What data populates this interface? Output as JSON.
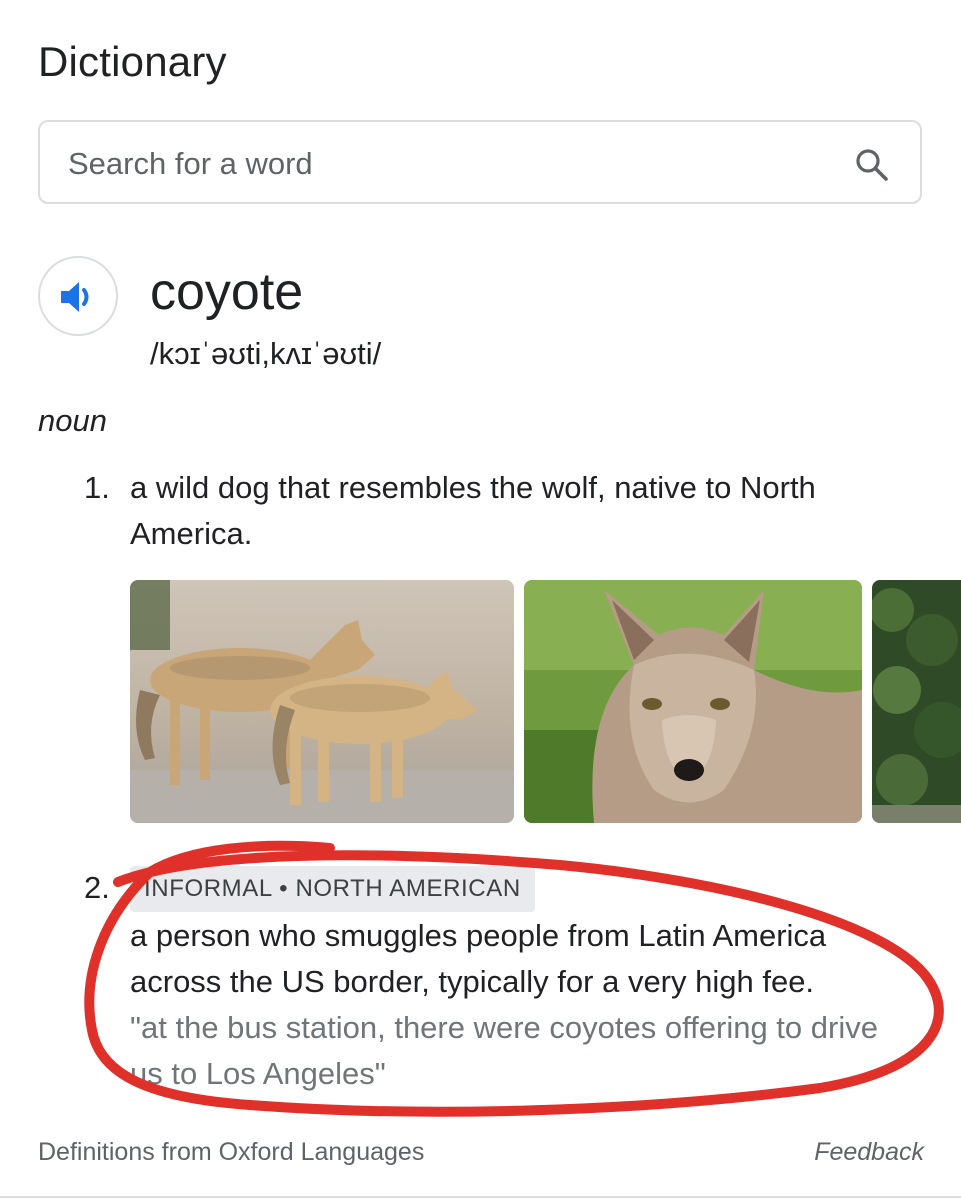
{
  "header": {
    "title": "Dictionary"
  },
  "search": {
    "placeholder": "Search for a word",
    "icon": "search-icon"
  },
  "entry": {
    "word": "coyote",
    "phonetic": "/kɔɪˈəʊti,kʌɪˈəʊti/",
    "audio_icon": "speaker-icon",
    "part_of_speech": "noun"
  },
  "definitions": [
    {
      "number": "1.",
      "line1": "a wild dog that resembles the wolf, native to North",
      "line2": "America."
    },
    {
      "number": "2.",
      "tag": "INFORMAL • NORTH AMERICAN",
      "line1": "a person who smuggles people from Latin America",
      "line2": "across the US border, typically for a very high fee.",
      "example_line1": "\"at the bus station, there were coyotes offering to drive",
      "example_line2": "us to Los Angeles\""
    }
  ],
  "footer": {
    "source": "Definitions from Oxford Languages",
    "feedback": "Feedback"
  },
  "colors": {
    "accent_blue": "#1a73e8",
    "annotation_red": "#e0302a",
    "text": "#202124",
    "muted": "#70757a"
  }
}
